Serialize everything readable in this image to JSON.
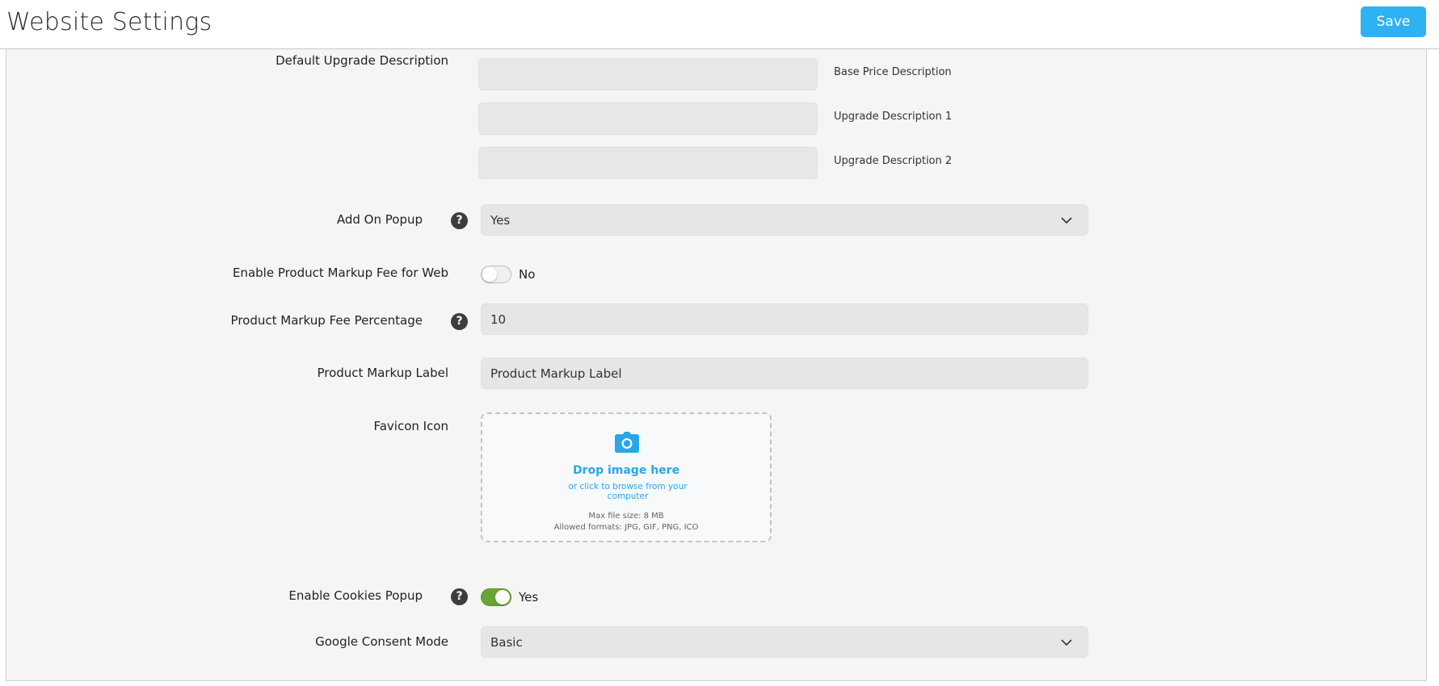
{
  "header": {
    "title": "Website Settings",
    "save_label": "Save"
  },
  "upgrade": {
    "label": "Default Upgrade Description",
    "fields": [
      {
        "caption": "Base Price Description",
        "value": ""
      },
      {
        "caption": "Upgrade Description 1",
        "value": ""
      },
      {
        "caption": "Upgrade Description 2",
        "value": ""
      }
    ]
  },
  "add_on_popup": {
    "label": "Add On Popup",
    "value": "Yes"
  },
  "markup_fee_web": {
    "label": "Enable Product Markup Fee for Web",
    "enabled": false,
    "state_text": "No"
  },
  "markup_fee_percentage": {
    "label": "Product Markup Fee Percentage",
    "value": "10"
  },
  "markup_label": {
    "label": "Product Markup Label",
    "value": "Product Markup Label"
  },
  "favicon": {
    "label": "Favicon Icon",
    "drop_title": "Drop image here",
    "drop_subtitle": "or click to browse from your computer",
    "max_size": "Max file size: 8 MB",
    "formats": "Allowed formats: JPG, GIF, PNG, ICO",
    "icon": "camera-icon"
  },
  "cookies_popup": {
    "label": "Enable Cookies Popup",
    "enabled": true,
    "state_text": "Yes"
  },
  "consent_mode": {
    "label": "Google Consent Mode",
    "value": "Basic"
  },
  "colors": {
    "accent": "#2eb2f3",
    "toggle_on": "#6aa534",
    "help_icon": "#3d3d3d"
  }
}
